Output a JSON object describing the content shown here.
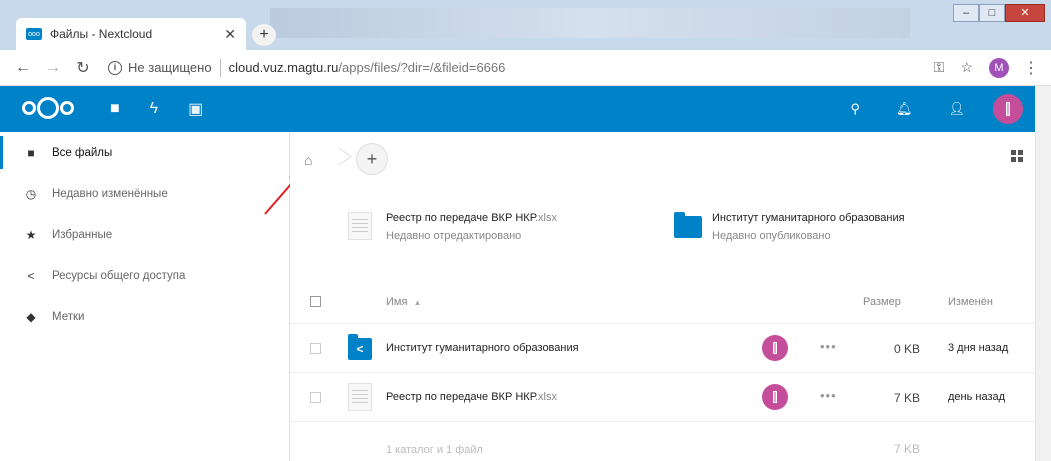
{
  "browser": {
    "tab_title": "Файлы - Nextcloud",
    "insecure_label": "Не защищено",
    "url_host": "cloud.vuz.magtu.ru",
    "url_path": "/apps/files/?dir=/&fileid=6666",
    "profile_initial": "M"
  },
  "sidebar": {
    "items": [
      {
        "label": "Все файлы",
        "icon": "folder-icon"
      },
      {
        "label": "Недавно изменённые",
        "icon": "clock-icon"
      },
      {
        "label": "Избранные",
        "icon": "star-icon"
      },
      {
        "label": "Ресурсы общего доступа",
        "icon": "share-icon"
      },
      {
        "label": "Метки",
        "icon": "tag-icon"
      }
    ]
  },
  "recent": [
    {
      "name": "Реестр по передаче ВКР НКР",
      "ext": ".xlsx",
      "status": "Недавно отредактировано"
    },
    {
      "name": "Институт гуманитарного образования",
      "ext": "",
      "status": "Недавно опубликовано"
    }
  ],
  "table": {
    "headers": {
      "name": "Имя",
      "size": "Размер",
      "modified": "Изменён"
    },
    "rows": [
      {
        "name": "Институт гуманитарного образования",
        "ext": "",
        "size": "0 KB",
        "modified": "3 дня назад",
        "type": "shared-folder"
      },
      {
        "name": "Реестр по передаче ВКР НКР",
        "ext": ".xlsx",
        "size": "7 KB",
        "modified": "день назад",
        "type": "xlsx"
      }
    ],
    "summary": "1 каталог и 1 файл",
    "summary_size": "7 KB"
  },
  "colors": {
    "brand": "#0082c9",
    "avatar": "#c44e9a"
  }
}
